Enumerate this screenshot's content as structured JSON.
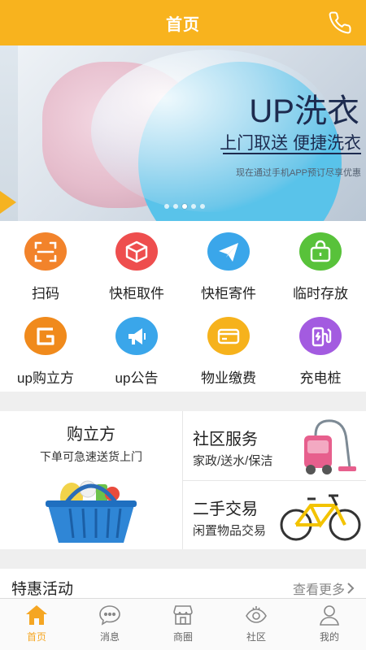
{
  "header": {
    "title": "首页"
  },
  "banner": {
    "title": "UP洗衣",
    "subtitle": "上门取送 便捷洗衣",
    "note": "现在通过手机APP预订尽享优惠"
  },
  "services": [
    {
      "label": "扫码",
      "icon": "scan-icon",
      "color": "#f2832b"
    },
    {
      "label": "快柜取件",
      "icon": "box-icon",
      "color": "#ee4e4e"
    },
    {
      "label": "快柜寄件",
      "icon": "send-icon",
      "color": "#3aa6ea"
    },
    {
      "label": "临时存放",
      "icon": "storage-icon",
      "color": "#58c23a"
    },
    {
      "label": "up购立方",
      "icon": "shop-g-icon",
      "color": "#f08a1c"
    },
    {
      "label": "up公告",
      "icon": "megaphone-icon",
      "color": "#3aa6ea"
    },
    {
      "label": "物业缴费",
      "icon": "card-icon",
      "color": "#f6b21c"
    },
    {
      "label": "充电桩",
      "icon": "charger-icon",
      "color": "#a35be0"
    }
  ],
  "promo": {
    "left": {
      "title": "购立方",
      "subtitle": "下单可急速送货上门"
    },
    "community": {
      "title": "社区服务",
      "subtitle": "家政/送水/保洁"
    },
    "secondhand": {
      "title": "二手交易",
      "subtitle": "闲置物品交易"
    }
  },
  "special": {
    "title": "特惠活动",
    "more": "查看更多"
  },
  "tabs": [
    {
      "label": "首页",
      "icon": "home-icon"
    },
    {
      "label": "消息",
      "icon": "message-icon"
    },
    {
      "label": "商圈",
      "icon": "store-icon"
    },
    {
      "label": "社区",
      "icon": "eye-icon"
    },
    {
      "label": "我的",
      "icon": "user-icon"
    }
  ],
  "colors": {
    "brand": "#f8b31e",
    "active_tab": "#f5a623"
  }
}
